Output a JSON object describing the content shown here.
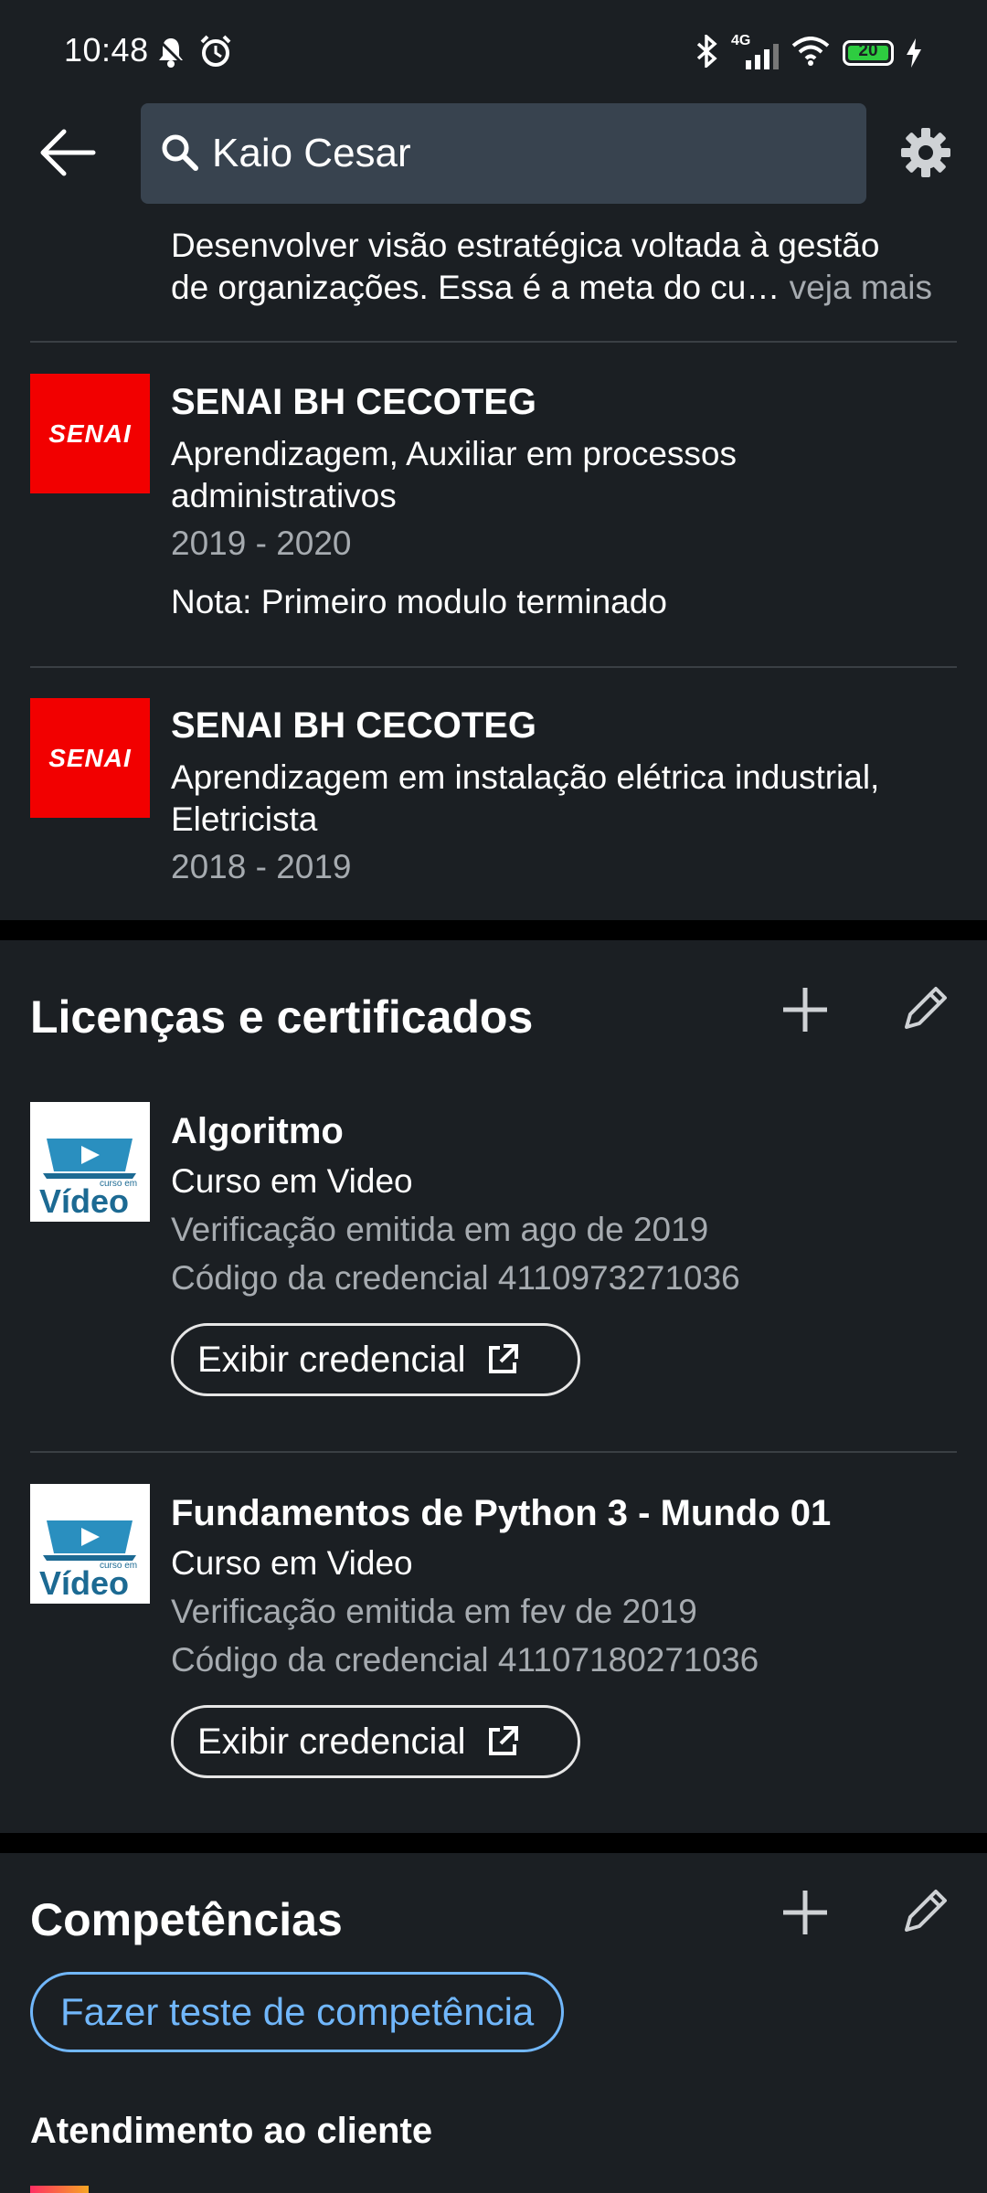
{
  "status_bar": {
    "time": "10:48",
    "network": "4G",
    "battery": "20",
    "icons": [
      "bell-icon",
      "alarm-icon",
      "bluetooth-icon",
      "signal-icon",
      "wifi-icon",
      "battery-icon",
      "charging-icon"
    ]
  },
  "app_bar": {
    "back_icon": "arrow-left-icon",
    "search_value": "Kaio Cesar",
    "search_icon": "search-icon",
    "settings_icon": "gear-icon"
  },
  "education": {
    "truncated_text_line1": "Desenvolver visão estratégica voltada à gestão",
    "truncated_text_line2": "de organizações. Essa é a meta do cu…",
    "see_more": " veja mais",
    "items": [
      {
        "logo_text": "SENAI",
        "school": "SENAI BH CECOTEG",
        "degree_line1": "Aprendizagem, Auxiliar em processos",
        "degree_line2": "administrativos",
        "dates": "2019 - 2020",
        "note": "Nota: Primeiro modulo terminado"
      },
      {
        "logo_text": "SENAI",
        "school": "SENAI BH CECOTEG",
        "degree_line1": "Aprendizagem em instalação elétrica industrial,",
        "degree_line2": "Eletricista",
        "dates": "2018 - 2019"
      }
    ]
  },
  "licenses": {
    "title": "Licenças e certificados",
    "items": [
      {
        "logo_text": "Vídeo",
        "logo_small": "curso em",
        "name": "Algoritmo",
        "issuer": "Curso em Video",
        "issued": "Verificação emitida em ago de 2019",
        "credential": "Código da credencial 4110973271036",
        "button": "Exibir credencial"
      },
      {
        "logo_text": "Vídeo",
        "logo_small": "curso em",
        "name": "Fundamentos de Python 3 - Mundo 01",
        "issuer": "Curso em Video",
        "issued": "Verificação emitida em fev de 2019",
        "credential": "Código da credencial 41107180271036",
        "button": "Exibir credencial"
      }
    ]
  },
  "skills": {
    "title": "Competências",
    "test_button": "Fazer teste de competência",
    "first_skill": "Atendimento ao cliente"
  },
  "colors": {
    "background": "#1b1f23",
    "search_bg": "#38434f",
    "senai_red": "#f20000",
    "link_blue": "#71b7fb",
    "muted": "#a6abb0"
  }
}
